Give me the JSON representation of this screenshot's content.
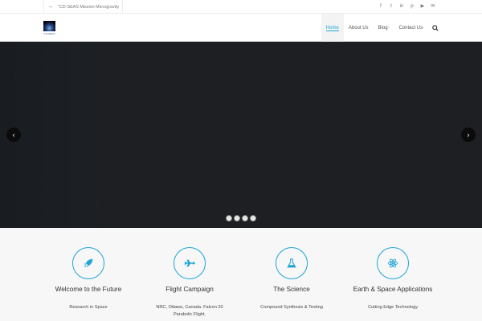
{
  "topbar": {
    "announcement": "\"CD-SEAS Mission Microgravity",
    "social_icons": [
      "facebook-icon",
      "twitter-icon",
      "linkedin-icon",
      "pinterest-icon",
      "youtube-icon",
      "mail-icon"
    ]
  },
  "header": {
    "logo_text": "CD-SEAS",
    "nav": [
      {
        "label": "Home",
        "active": true,
        "has_submenu": false
      },
      {
        "label": "About Us",
        "active": false,
        "has_submenu": false
      },
      {
        "label": "Blog",
        "active": false,
        "has_submenu": true
      },
      {
        "label": "Contact Us",
        "active": false,
        "has_submenu": true
      }
    ],
    "submenu_marker": "*"
  },
  "slider": {
    "prev_glyph": "‹",
    "next_glyph": "›",
    "dot_count": 4
  },
  "features": [
    {
      "icon": "rocket-icon",
      "title": "Welcome to the Future",
      "text": "Research in Space"
    },
    {
      "icon": "plane-icon",
      "title": "Flight Campaign",
      "text": "NRC, Ottawa, Canada. Falcon 20 Parabolic Flight."
    },
    {
      "icon": "flask-icon",
      "title": "The Science",
      "text": "Compound Synthesis & Testing"
    },
    {
      "icon": "atom-icon",
      "title": "Earth & Space Applications",
      "text": "Cutting Edge Technology"
    }
  ],
  "colors": {
    "accent": "#1fa5d6",
    "slider_bg": "#1d1f22",
    "features_bg": "#f7f7f7"
  }
}
